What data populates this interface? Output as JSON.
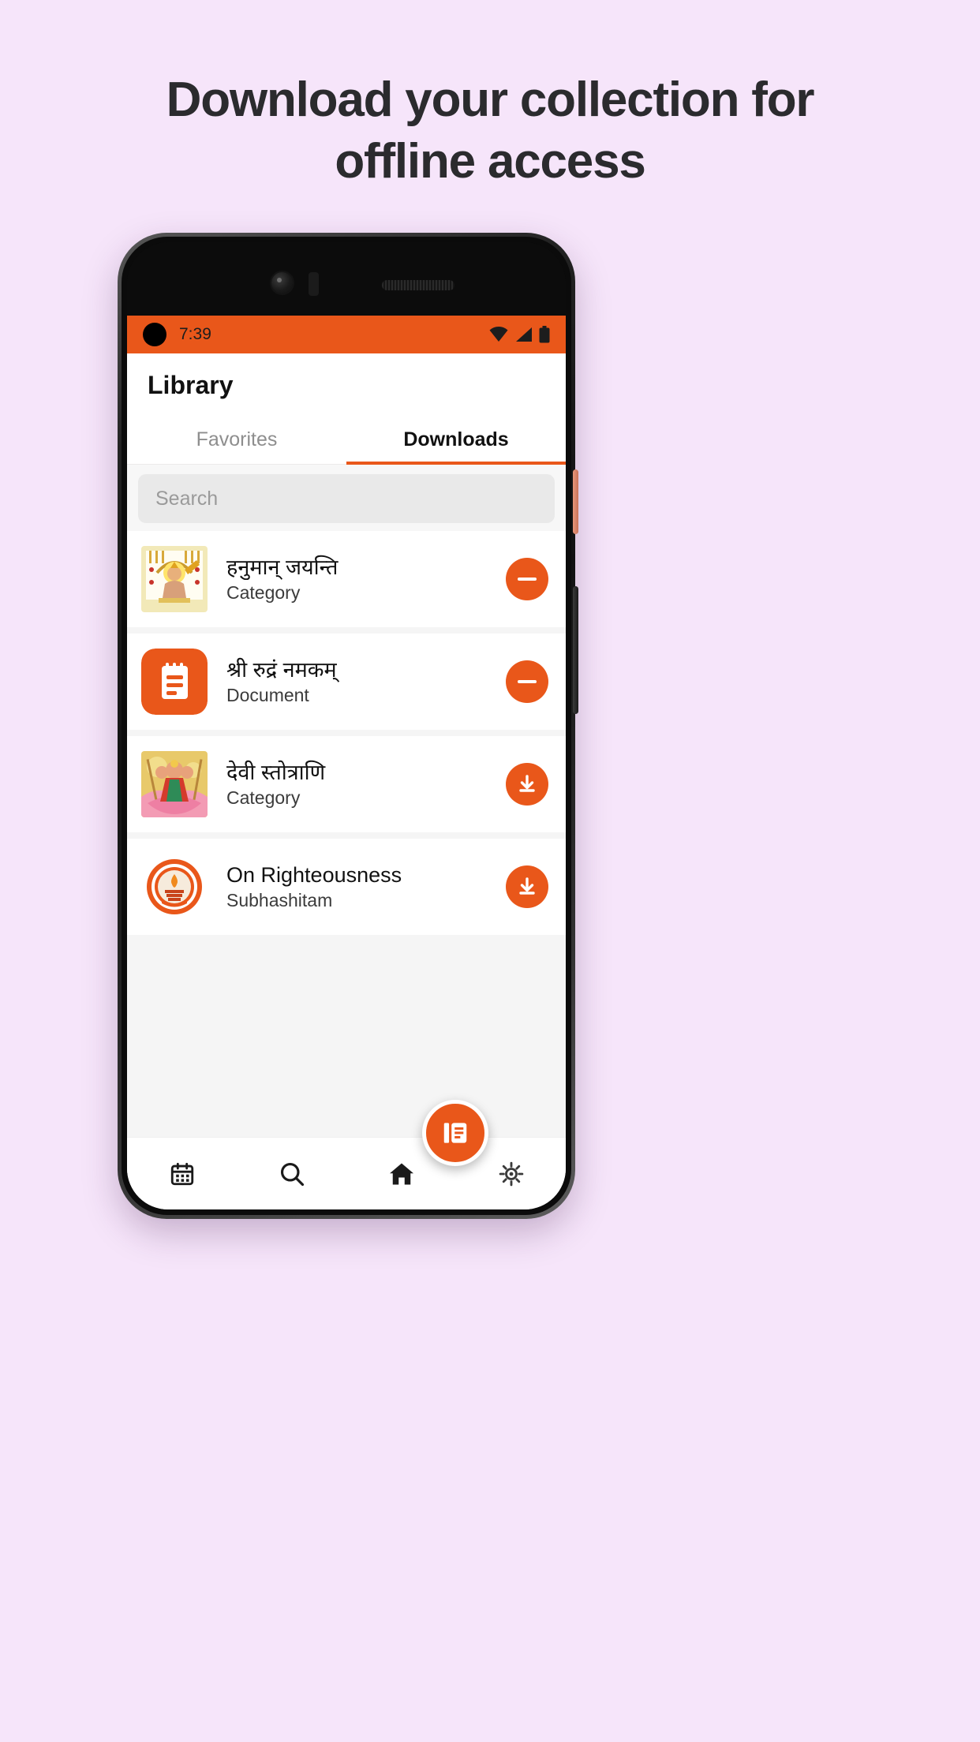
{
  "promo": {
    "headline_line1": "Download your collection for",
    "headline_line2": "offline access",
    "background_color": "#F6E5FA",
    "text_color": "#2B2B2E"
  },
  "theme": {
    "accent": "#E9571A",
    "screen_bg": "#F5F5F5",
    "card_bg": "#FFFFFF"
  },
  "statusbar": {
    "time": "7:39",
    "icons": [
      "wifi-icon",
      "signal-icon",
      "battery-icon"
    ]
  },
  "header": {
    "title": "Library"
  },
  "tabs": [
    {
      "label": "Favorites",
      "active": false
    },
    {
      "label": "Downloads",
      "active": true
    }
  ],
  "search": {
    "placeholder": "Search",
    "value": ""
  },
  "list": [
    {
      "title": "हनुमान् जयन्ति",
      "subtitle": "Category",
      "thumb": "hanuman-image",
      "action": "remove-download-icon"
    },
    {
      "title": "श्री रुद्रं नमकम्",
      "subtitle": "Document",
      "thumb": "document-icon",
      "action": "remove-download-icon"
    },
    {
      "title": "देवी स्तोत्राणि",
      "subtitle": "Category",
      "thumb": "devi-image",
      "action": "download-icon"
    },
    {
      "title": "On Righteousness",
      "subtitle": "Subhashitam",
      "thumb": "lamp-emblem-image",
      "action": "download-icon"
    }
  ],
  "bottomnav": {
    "items": [
      {
        "icon": "calendar-icon"
      },
      {
        "icon": "search-icon"
      },
      {
        "icon": "home-icon"
      },
      {
        "icon": "settings-gear-icon"
      }
    ],
    "fab_icon": "documents-icon"
  }
}
